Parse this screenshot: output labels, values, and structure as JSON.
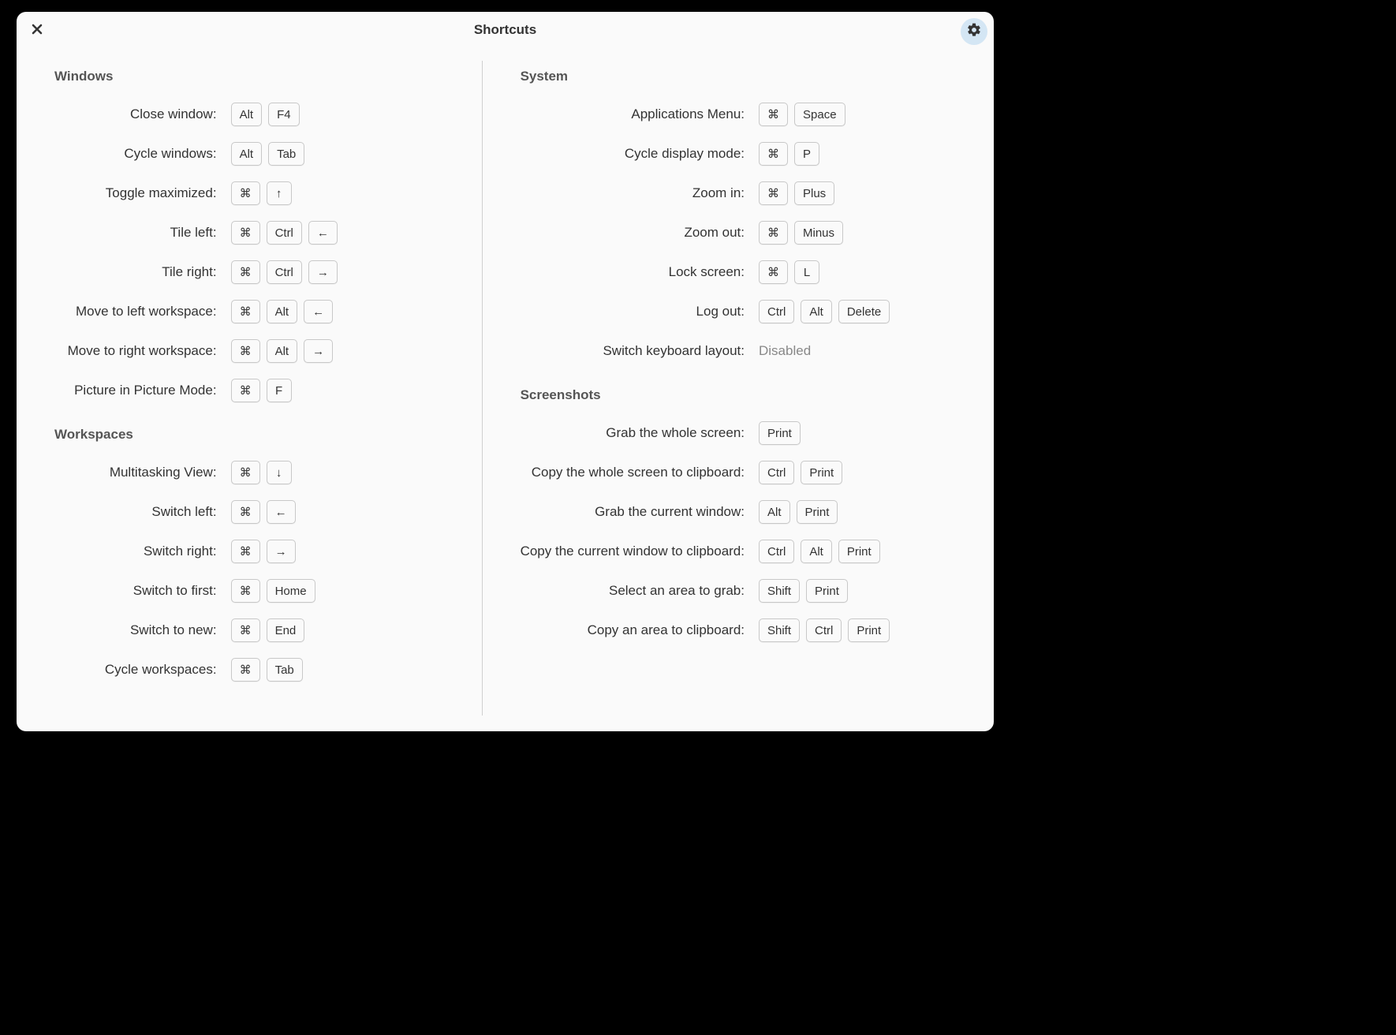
{
  "title": "Shortcuts",
  "left": {
    "sections": [
      {
        "name": "windows",
        "title": "Windows",
        "rows": [
          {
            "name": "close-window",
            "label": "Close window:",
            "keys": [
              "Alt",
              "F4"
            ]
          },
          {
            "name": "cycle-windows",
            "label": "Cycle windows:",
            "keys": [
              "Alt",
              "Tab"
            ]
          },
          {
            "name": "toggle-maximized",
            "label": "Toggle maximized:",
            "keys": [
              "⌘",
              "↑"
            ]
          },
          {
            "name": "tile-left",
            "label": "Tile left:",
            "keys": [
              "⌘",
              "Ctrl",
              "←"
            ]
          },
          {
            "name": "tile-right",
            "label": "Tile right:",
            "keys": [
              "⌘",
              "Ctrl",
              "→"
            ]
          },
          {
            "name": "move-ws-left",
            "label": "Move to left workspace:",
            "keys": [
              "⌘",
              "Alt",
              "←"
            ]
          },
          {
            "name": "move-ws-right",
            "label": "Move to right workspace:",
            "keys": [
              "⌘",
              "Alt",
              "→"
            ]
          },
          {
            "name": "pip-mode",
            "label": "Picture in Picture Mode:",
            "keys": [
              "⌘",
              "F"
            ]
          }
        ]
      },
      {
        "name": "workspaces",
        "title": "Workspaces",
        "rows": [
          {
            "name": "multitasking-view",
            "label": "Multitasking View:",
            "keys": [
              "⌘",
              "↓"
            ]
          },
          {
            "name": "switch-left",
            "label": "Switch left:",
            "keys": [
              "⌘",
              "←"
            ]
          },
          {
            "name": "switch-right",
            "label": "Switch right:",
            "keys": [
              "⌘",
              "→"
            ]
          },
          {
            "name": "switch-first",
            "label": "Switch to first:",
            "keys": [
              "⌘",
              "Home"
            ]
          },
          {
            "name": "switch-new",
            "label": "Switch to new:",
            "keys": [
              "⌘",
              "End"
            ]
          },
          {
            "name": "cycle-workspaces",
            "label": "Cycle workspaces:",
            "keys": [
              "⌘",
              "Tab"
            ]
          }
        ]
      }
    ]
  },
  "right": {
    "sections": [
      {
        "name": "system",
        "title": "System",
        "rows": [
          {
            "name": "applications-menu",
            "label": "Applications Menu:",
            "keys": [
              "⌘",
              "Space"
            ]
          },
          {
            "name": "cycle-display",
            "label": "Cycle display mode:",
            "keys": [
              "⌘",
              "P"
            ]
          },
          {
            "name": "zoom-in",
            "label": "Zoom in:",
            "keys": [
              "⌘",
              "Plus"
            ]
          },
          {
            "name": "zoom-out",
            "label": "Zoom out:",
            "keys": [
              "⌘",
              "Minus"
            ]
          },
          {
            "name": "lock-screen",
            "label": "Lock screen:",
            "keys": [
              "⌘",
              "L"
            ]
          },
          {
            "name": "log-out",
            "label": "Log out:",
            "keys": [
              "Ctrl",
              "Alt",
              "Delete"
            ]
          },
          {
            "name": "switch-kb-layout",
            "label": "Switch keyboard layout:",
            "disabled": "Disabled"
          }
        ]
      },
      {
        "name": "screenshots",
        "title": "Screenshots",
        "rows": [
          {
            "name": "grab-screen",
            "label": "Grab the whole screen:",
            "keys": [
              "Print"
            ]
          },
          {
            "name": "copy-screen",
            "label": "Copy the whole screen to clipboard:",
            "keys": [
              "Ctrl",
              "Print"
            ]
          },
          {
            "name": "grab-window",
            "label": "Grab the current window:",
            "keys": [
              "Alt",
              "Print"
            ]
          },
          {
            "name": "copy-window",
            "label": "Copy the current window to clipboard:",
            "keys": [
              "Ctrl",
              "Alt",
              "Print"
            ]
          },
          {
            "name": "select-area",
            "label": "Select an area to grab:",
            "keys": [
              "Shift",
              "Print"
            ]
          },
          {
            "name": "copy-area",
            "label": "Copy an area to clipboard:",
            "keys": [
              "Shift",
              "Ctrl",
              "Print"
            ]
          }
        ]
      }
    ]
  }
}
